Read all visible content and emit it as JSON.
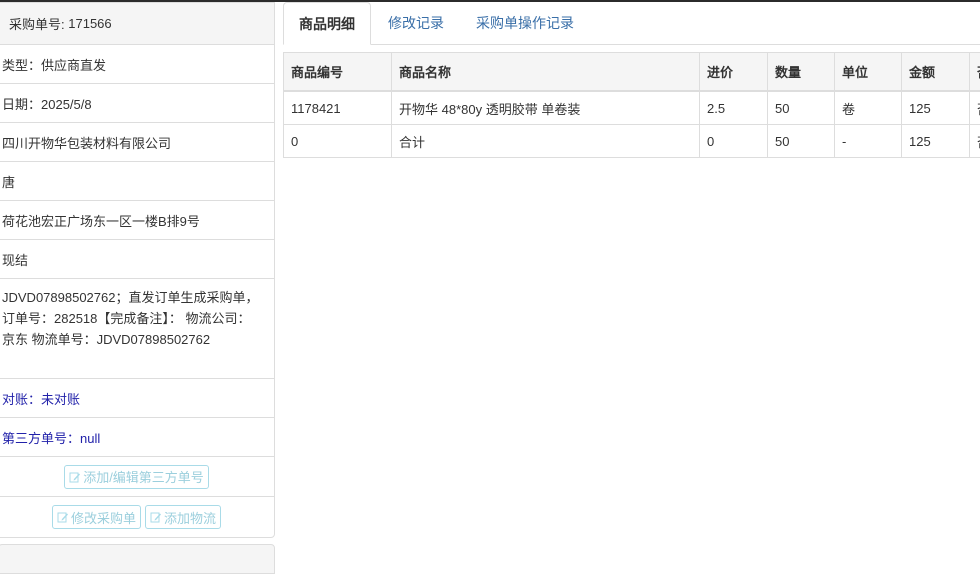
{
  "order": {
    "label": "采购单号:",
    "number": "171566"
  },
  "info_rows": [
    {
      "text": "类型：供应商直发"
    },
    {
      "text": "日期：2025/5/8"
    },
    {
      "text": "四川开物华包装材料有限公司"
    },
    {
      "text": "唐"
    },
    {
      "text": "荷花池宏正广场东一区一楼B排9号"
    },
    {
      "text": "现结"
    }
  ],
  "remark": "JDVD07898502762；直发订单生成采购单，订单号：282518【完成备注】：  物流公司：京东 物流单号：JDVD07898502762",
  "reconcile": "对账：未对账",
  "third_party": "第三方单号：null",
  "buttons": {
    "edit_third_party": "添加/编辑第三方单号",
    "modify_order": "修改采购单",
    "add_logistics": "添加物流"
  },
  "tabs": [
    {
      "label": "商品明细",
      "active": true
    },
    {
      "label": "修改记录",
      "active": false
    },
    {
      "label": "采购单操作记录",
      "active": false
    }
  ],
  "table": {
    "headers": [
      "商品编号",
      "商品名称",
      "进价",
      "数量",
      "单位",
      "金额",
      "否"
    ],
    "rows": [
      [
        "1178421",
        "开物华 48*80y 透明胶带 单卷装",
        "2.5",
        "50",
        "卷",
        "125",
        "否"
      ],
      [
        "0",
        "合计",
        "0",
        "50",
        "-",
        "125",
        "否"
      ]
    ]
  },
  "colors": {
    "link": "#3a6fa8",
    "info_blue": "#2222aa",
    "button_border": "#a9dbe8"
  }
}
